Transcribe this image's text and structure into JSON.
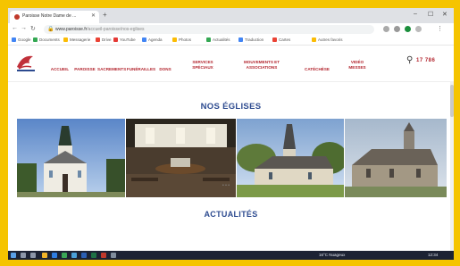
{
  "browser": {
    "tab_title": "Paroisse Notre Dame de ...",
    "new_tab": "+",
    "url_host": "www.paroisse.fr",
    "url_path": "/accueil-paroisse/nos-eglises",
    "bookmarks": [
      "Google",
      "Documents",
      "Messagerie",
      "Drive",
      "YouTube",
      "Agenda",
      "Photos",
      "Actualités",
      "Traduction",
      "Cartes",
      "Autres favoris"
    ]
  },
  "site": {
    "nav": [
      "ACCUEIL",
      "PAROISSE",
      "SACREMENTS",
      "FUNÉRAILLES",
      "DONS",
      "SERVICES\nSPÉCIAUX",
      "MOUVEMENTS ET\nASSOCIATIONS",
      "CATÉCHÈSE",
      "VIDÉO\nMESSES"
    ],
    "brand_small": "17 786",
    "section_title": "NOS ÉGLISES",
    "news_title": "ACTUALITÉS",
    "carousel_dots": "• • •"
  },
  "taskbar": {
    "tray_text": "16°C Nuageux",
    "clock": "12:34"
  },
  "colors": {
    "accent_red": "#b3262f",
    "heading_blue": "#2c4a8f",
    "frame_yellow": "#f5c400"
  },
  "icons": [
    "search-icon",
    "back-icon",
    "forward-icon",
    "reload-icon",
    "lock-icon",
    "windows-start-icon"
  ]
}
